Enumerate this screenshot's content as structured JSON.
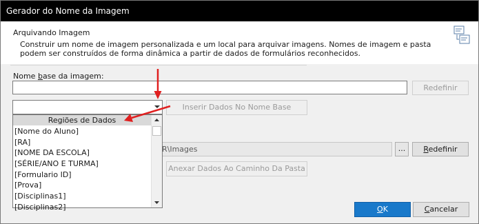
{
  "window": {
    "title": "Gerador do Nome da Imagem"
  },
  "header": {
    "title": "Arquivando Imagem",
    "description": "Construir um nome de imagem personalizada e um local para arquivar imagens. Nomes de imagem e pasta podem ser construídos de forma dinâmica a partir de dados de formulários reconhecidos.",
    "icon": "document-stack-icon"
  },
  "base_name": {
    "label_prefix": "Nome ",
    "label_underlined": "b",
    "label_suffix": "ase da imagem:",
    "value": "",
    "reset_label": "Redefinir"
  },
  "data_regions": {
    "selected": "",
    "insert_label": "Inserir Dados No Nome Base",
    "header": "Regiões de Dados",
    "items": [
      "[Nome do Aluno]",
      "[RA]",
      "[NOME DA ESCOLA]",
      "[SÉRIE/ANO E TURMA]",
      "[Formulario ID]",
      "[Prova]",
      "[Disciplinas1]",
      "[Disciplinas2]"
    ]
  },
  "folder": {
    "path_visible": "R\\Images",
    "browse_label": "...",
    "reset_label": "Redefinir",
    "append_label": "Anexar Dados Ao Caminho Da Pasta"
  },
  "footer": {
    "ok_label": "OK",
    "cancel_label": "Cancelar"
  },
  "colors": {
    "titlebar": "#000000",
    "ok_button": "#1979ca",
    "annotation_arrow": "#e02020"
  }
}
